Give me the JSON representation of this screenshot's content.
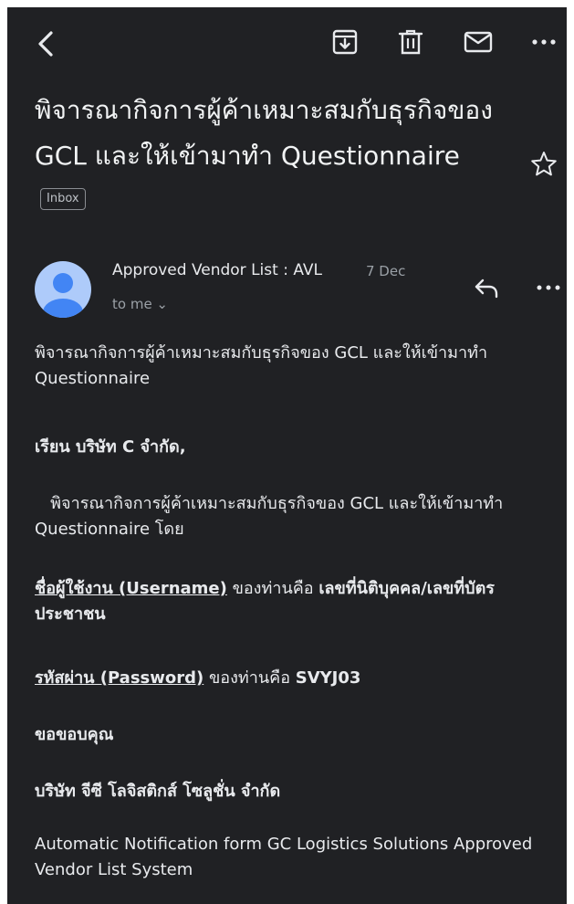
{
  "icons": {
    "back": "chevron-left-icon",
    "archive": "archive-icon",
    "delete": "trash-icon",
    "mark_unread": "mail-icon",
    "more": "more-horizontal-icon",
    "star": "star-icon",
    "reply": "reply-icon"
  },
  "subject": "พิจารณากิจการผู้ค้าเหมาะสมกับธุรกิจของ GCL และให้เข้ามาทำ Questionnaire",
  "label": "Inbox",
  "sender": {
    "name": "Approved Vendor List : AVL",
    "date": "7 Dec",
    "recipient": "to me ⌄"
  },
  "body": {
    "intro": "พิจารณากิจการผู้ค้าเหมาะสมกับธุรกิจของ GCL และให้เข้ามาทำ Questionnaire",
    "greeting": "เรียน บริษัท C จำกัด,",
    "paragraph": "   พิจารณากิจการผู้ค้าเหมาะสมกับธุรกิจของ GCL และให้เข้ามาทำ Questionnaire โดย",
    "username_label": "ชื่อผู้ใช้งาน (Username)",
    "username_mid": " ของท่านคือ ",
    "username_value": "เลขที่นิติบุคคล/เลขที่บัตรประชาชน",
    "password_label": "รหัสผ่าน (Password)",
    "password_mid": " ของท่านคือ ",
    "password_value": "SVYJ03",
    "thanks": "ขอขอบคุณ",
    "company": "บริษัท จีซี โลจิสติกส์ โซลูชั่น จำกัด",
    "footer": "Automatic Notification form GC Logistics Solutions Approved Vendor List System"
  },
  "colors": {
    "background": "#202124",
    "text": "#e8eaed",
    "muted": "#9aa0a6",
    "avatar": "#aecbfa",
    "avatar_figure": "#4285f4"
  }
}
